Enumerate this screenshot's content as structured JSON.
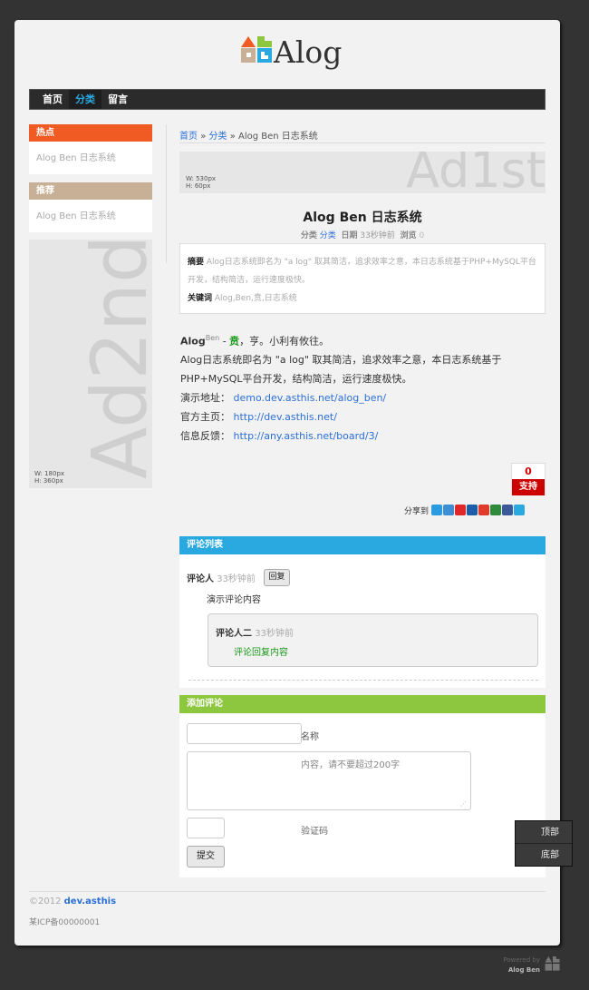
{
  "logo": {
    "text": "Alog"
  },
  "nav": {
    "items": [
      {
        "label": "首页"
      },
      {
        "label": "分类",
        "active": true
      },
      {
        "label": "留言"
      }
    ]
  },
  "sidebar": {
    "hot": {
      "title": "热点",
      "items": [
        "Alog Ben 日志系统"
      ]
    },
    "recommend": {
      "title": "推荐",
      "items": [
        "Alog Ben 日志系统"
      ]
    },
    "ad": {
      "text": "Ad2nd",
      "w": "W: 180px",
      "h": "H:  360px"
    }
  },
  "breadcrumb": {
    "home": "首页",
    "sep1": "»",
    "category": "分类",
    "sep2": "»",
    "current": "Alog Ben 日志系统"
  },
  "ad1": {
    "text": "Ad1st",
    "w": "W: 530px",
    "h": "H: 60px"
  },
  "post": {
    "title": "Alog Ben 日志系统",
    "meta": {
      "category_label": "分类",
      "category": "分类",
      "date_label": "日期",
      "date": "33秒钟前",
      "views_label": "浏览",
      "views": "0"
    },
    "summary_label": "摘要",
    "summary": "Alog日志系统即名为 \"a log\" 取其简洁，追求效率之意，本日志系统基于PHP+MySQL平台开发，结构简洁，运行速度极快。",
    "keywords_label": "关键词",
    "keywords": "Alog,Ben,贲,日志系统",
    "body": {
      "brand": "Alog",
      "sup": "Ben",
      "dash": " - ",
      "hl": "贲",
      "motto": "，亨。小利有攸往。",
      "p1": "Alog日志系统即名为 \"a log\" 取其简洁，追求效率之意，本日志系统基于",
      "p2": "PHP+MySQL平台开发，结构简洁，运行速度极快。",
      "links": [
        {
          "label": "演示地址：",
          "url": "demo.dev.asthis.net/alog_ben/"
        },
        {
          "label": "官方主页：",
          "url": "http://dev.asthis.net/"
        },
        {
          "label": "信息反馈：",
          "url": "http://any.asthis.net/board/3/"
        }
      ]
    },
    "vote": {
      "count": "0",
      "label": "支持"
    },
    "share_label": "分享到",
    "share_icons": [
      {
        "name": "qzone-icon",
        "color": "#2a9be0"
      },
      {
        "name": "tencent-weibo-icon",
        "color": "#3c8fd4"
      },
      {
        "name": "sina-weibo-icon",
        "color": "#e0282b"
      },
      {
        "name": "renren-icon",
        "color": "#1d5ea8"
      },
      {
        "name": "kaixin-icon",
        "color": "#e03a2d"
      },
      {
        "name": "douban-icon",
        "color": "#2f8a3b"
      },
      {
        "name": "facebook-icon",
        "color": "#3b5998"
      },
      {
        "name": "twitter-icon",
        "color": "#2aa9e0"
      }
    ]
  },
  "comments": {
    "title": "评论列表",
    "color": "#29a9e0",
    "items": [
      {
        "author": "评论人",
        "time": "33秒钟前",
        "reply_label": "回复",
        "content": "演示评论内容",
        "replies": [
          {
            "author": "评论人二",
            "time": "33秒钟前",
            "content": "评论回复内容"
          }
        ]
      }
    ]
  },
  "add_comment": {
    "title": "添加评论",
    "color": "#8dc63f",
    "name_label": "名称",
    "content_placeholder": "内容，请不要超过200字",
    "captcha_label": "验证码",
    "submit_label": "提交"
  },
  "footer": {
    "copyright": "©2012",
    "site": "dev.asthis",
    "icp": "某ICP备00000001"
  },
  "float": {
    "top": "顶部",
    "bottom": "底部"
  },
  "powered": {
    "line1": "Powered by",
    "line2": "Alog Ben"
  }
}
